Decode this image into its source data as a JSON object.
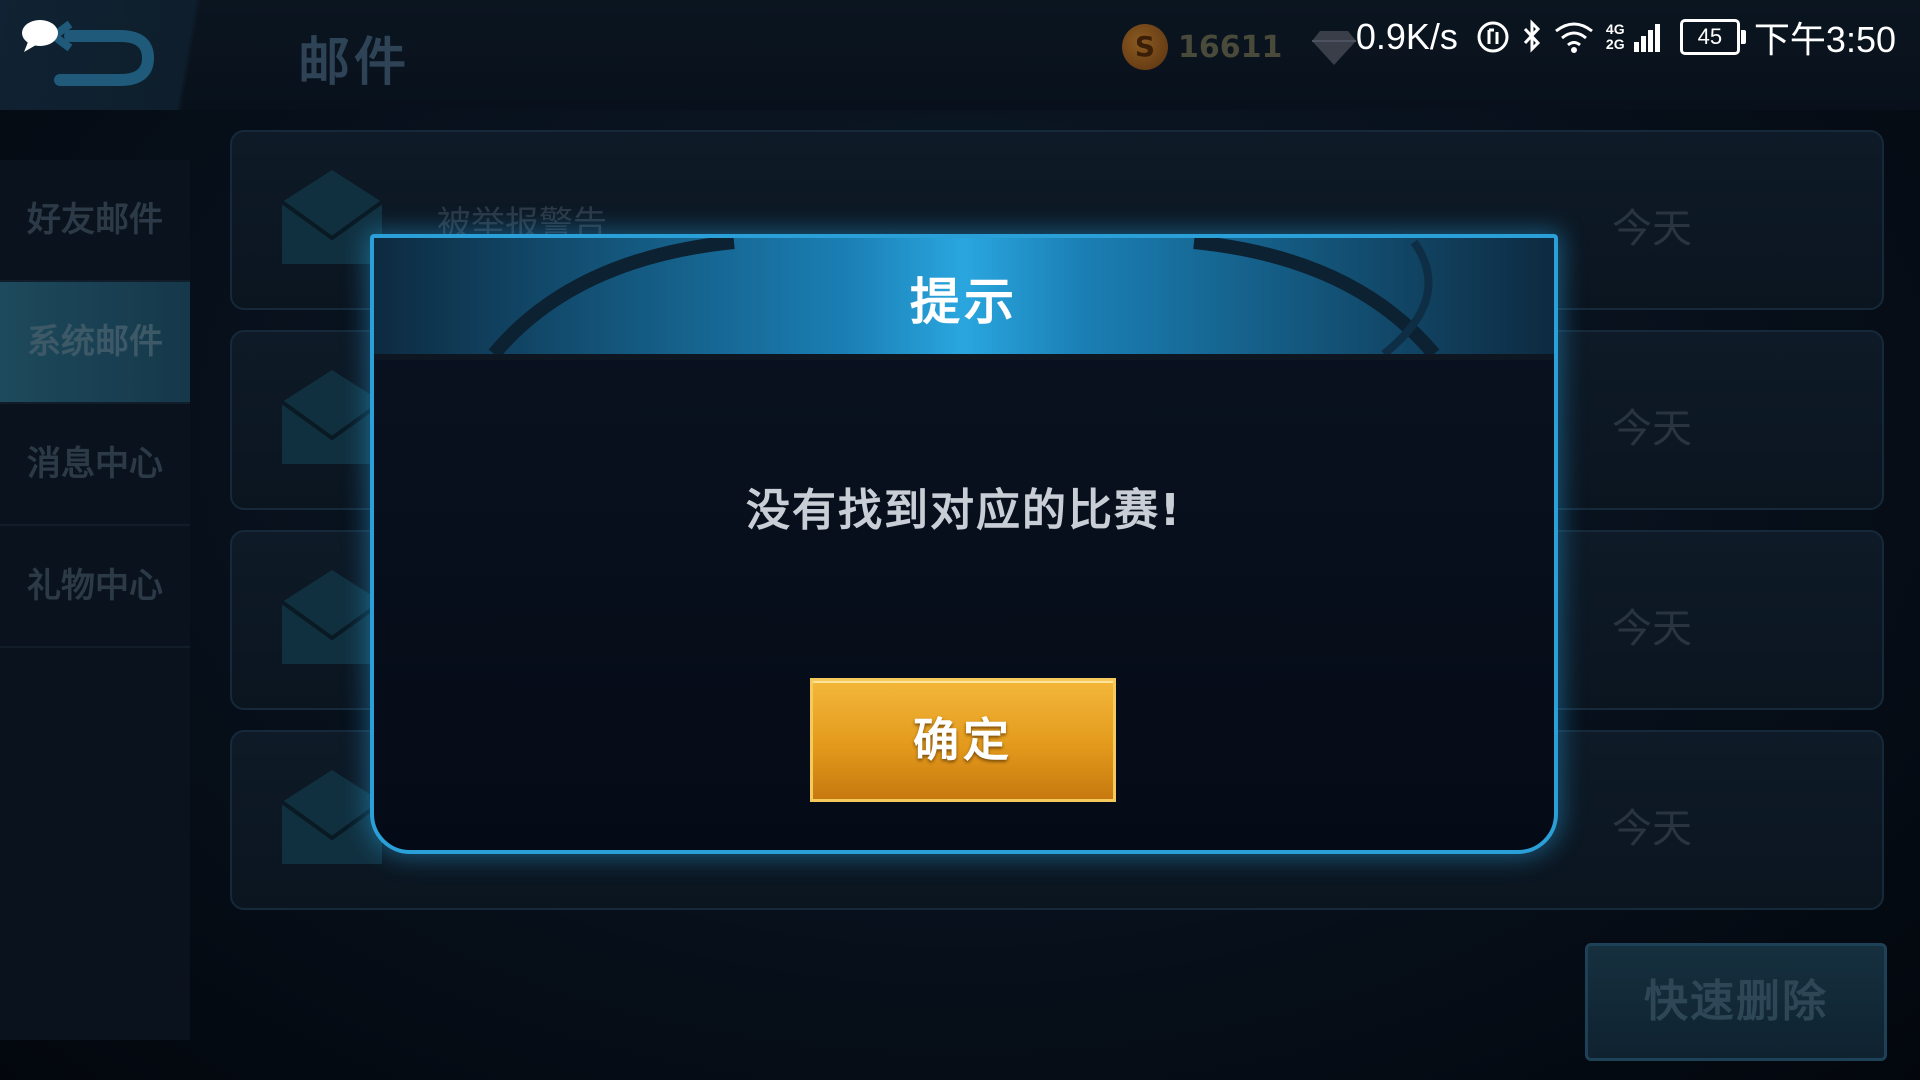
{
  "header": {
    "title": "邮件",
    "coins": "16611"
  },
  "status_bar": {
    "net_speed": "0.9K/s",
    "signal_label": "4G 2G",
    "battery": "45",
    "time": "下午3:50"
  },
  "sidebar": {
    "items": [
      {
        "label": "好友邮件",
        "active": false
      },
      {
        "label": "系统邮件",
        "active": true
      },
      {
        "label": "消息中心",
        "active": false
      },
      {
        "label": "礼物中心",
        "active": false
      }
    ]
  },
  "mails": [
    {
      "title": "被举报警告",
      "date": "今天"
    },
    {
      "title": "",
      "date": "今天"
    },
    {
      "title": "",
      "date": "今天"
    },
    {
      "title": "",
      "date": "今天"
    }
  ],
  "quick_delete_label": "快速删除",
  "dialog": {
    "title": "提示",
    "message": "没有找到对应的比赛!",
    "confirm_label": "确定"
  },
  "colors": {
    "accent": "#2a9fd8",
    "confirm": "#e39a1c"
  }
}
